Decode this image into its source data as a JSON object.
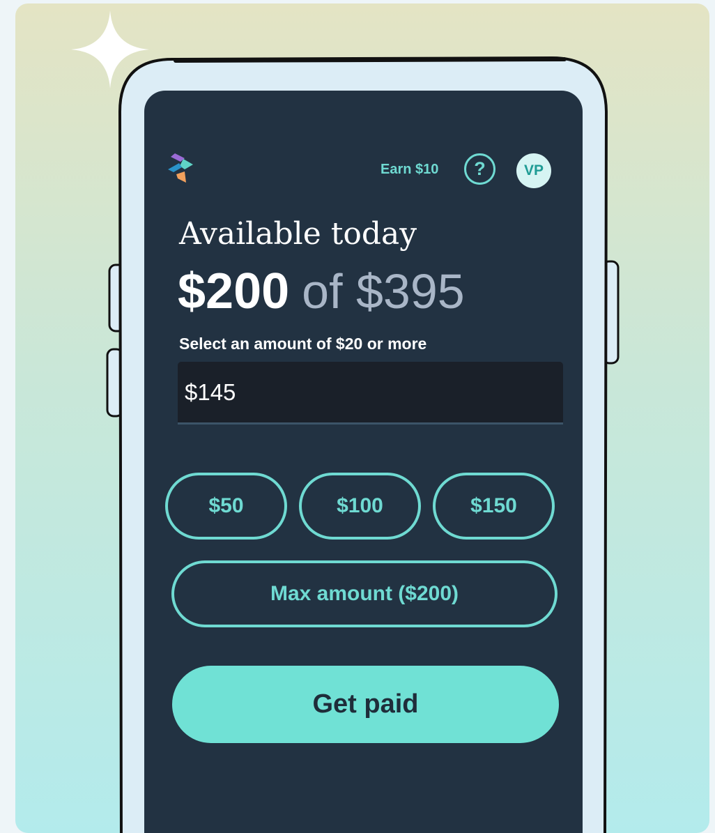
{
  "header": {
    "logo_icon": "brand-logo-icon",
    "earn_link": "Earn $10",
    "help_icon_glyph": "?",
    "avatar_initials": "VP"
  },
  "balance": {
    "heading": "Available today",
    "available_amount": "$200",
    "of_total": "of $395"
  },
  "amount_field": {
    "helper_text": "Select an amount of $20 or more",
    "value": "$145"
  },
  "quick_amounts": [
    "$50",
    "$100",
    "$150"
  ],
  "max_amount_label": "Max amount ($200)",
  "submit_label": "Get paid",
  "colors": {
    "accent": "#70e1d5",
    "screen_bg": "#223242",
    "input_bg": "#1a2029"
  }
}
